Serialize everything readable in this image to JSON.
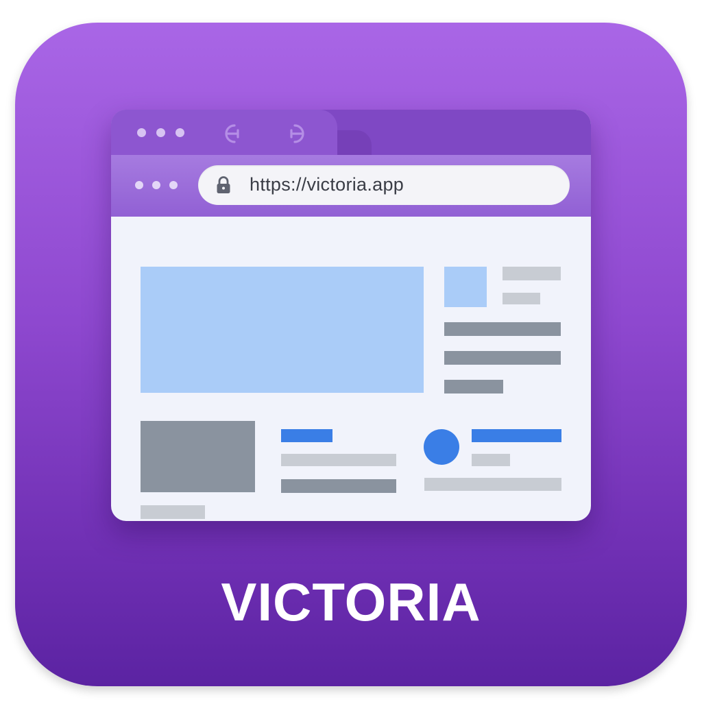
{
  "app_icon": {
    "brand_name": "VICTORIA",
    "background_gradient": [
      "#a966e6",
      "#5b23a2"
    ]
  },
  "browser": {
    "address_bar": {
      "url": "https://victoria.app",
      "icon": "lock-icon"
    },
    "titlebar_icons": [
      "window-dots-icon",
      "back-arrow-icon",
      "forward-arrow-icon"
    ],
    "toolbar_icons": [
      "menu-dots-icon",
      "lock-icon"
    ]
  },
  "colors": {
    "titlebar": "#7f48c4",
    "content_bg": "#f1f3fb",
    "accent_blue": "#3a7ee6",
    "placeholder_blue": "#aaccf8",
    "placeholder_gray_light": "#c8ccd3",
    "placeholder_gray_dark": "#8a939f"
  }
}
